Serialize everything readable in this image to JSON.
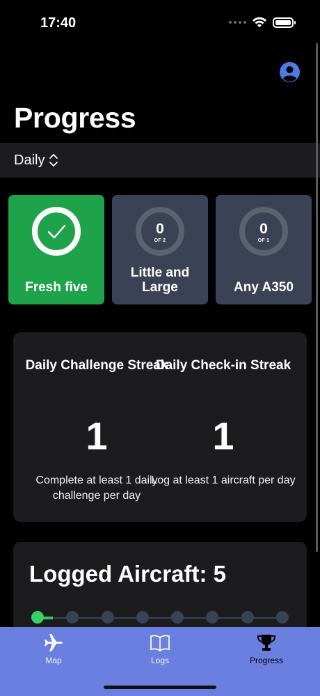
{
  "status_bar": {
    "time": "17:40"
  },
  "page": {
    "title": "Progress"
  },
  "period": {
    "label": "Daily"
  },
  "challenges": [
    {
      "label": "Fresh five",
      "completed": true,
      "count": "",
      "of": ""
    },
    {
      "label": "Little and Large",
      "completed": false,
      "count": "0",
      "of": "OF 2"
    },
    {
      "label": "Any A350",
      "completed": false,
      "count": "0",
      "of": "OF 1"
    }
  ],
  "streaks": [
    {
      "title": "Daily Challenge Streak",
      "value": "1",
      "description": "Complete at least 1 daily challenge per day"
    },
    {
      "title": "Daily Check-in Streak",
      "value": "1",
      "description": "Log at least 1 aircraft per day"
    }
  ],
  "logged": {
    "title": "Logged Aircraft: 5",
    "milestones": 8,
    "reached": 1
  },
  "tabs": [
    {
      "label": "Map",
      "icon": "airplane-icon",
      "selected": false
    },
    {
      "label": "Logs",
      "icon": "book-icon",
      "selected": false
    },
    {
      "label": "Progress",
      "icon": "trophy-icon",
      "selected": true
    }
  ],
  "colors": {
    "background": "#000000",
    "card": "#1c1c1e",
    "challenge_pending": "#3b4256",
    "challenge_done": "#1ea34a",
    "tab_bar": "#6b7fe0",
    "accent_green": "#34d364",
    "profile_blue": "#4f7be8"
  }
}
